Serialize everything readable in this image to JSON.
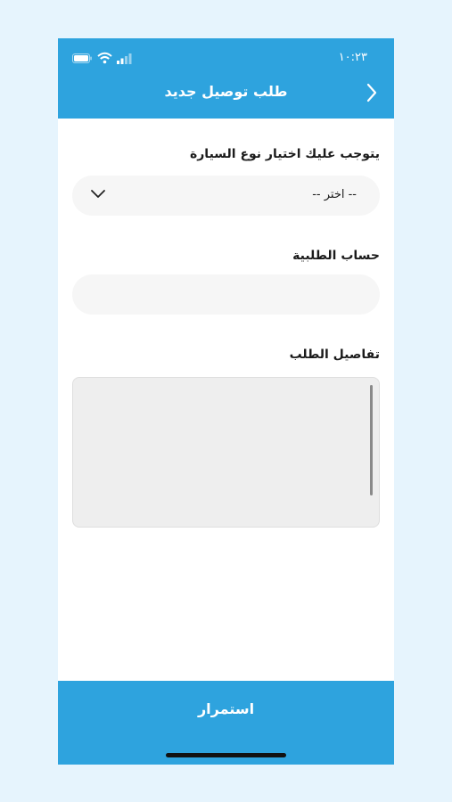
{
  "status_bar": {
    "time": "١٠:٢٣",
    "icons": [
      "battery-icon",
      "wifi-icon",
      "signal-icon"
    ]
  },
  "header": {
    "title": "طلب توصيل جديد",
    "back_icon": "chevron-right-icon",
    "color": "#2ea3de"
  },
  "form": {
    "car_type": {
      "label": "يتوجب عليك اختيار نوع السيارة",
      "selected_value": "-- اختر --",
      "icon": "chevron-down-icon"
    },
    "order_account": {
      "label": "حساب الطلبية",
      "value": ""
    },
    "order_details": {
      "label": "تفاصيل الطلب",
      "value": ""
    }
  },
  "footer": {
    "continue_label": "استمرار",
    "color": "#2ea3de"
  }
}
